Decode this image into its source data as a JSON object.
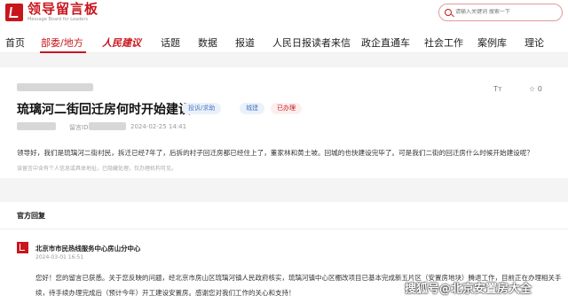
{
  "brand": {
    "name_cn": "领导留言板",
    "name_en": "Message Board for Leaders"
  },
  "search": {
    "placeholder": "请输入关键词 搜索一下"
  },
  "nav": {
    "items": [
      "首页",
      "部委/地方",
      "人民建议",
      "话题",
      "数据",
      "报道",
      "人民日报读者来信",
      "政企直通车",
      "社会工作",
      "案例库",
      "理论"
    ]
  },
  "post": {
    "title": "琉璃河二街回迁房何时开始建设",
    "tags": [
      "投诉/求助",
      "城建",
      "已办理"
    ],
    "meta_label": "留言ID",
    "date": "2024-02-25 14:41",
    "content": "领导好，我们是琉璃河二街村民，拆迁已经7年了，后拆的村子回迁房都已经住上了，董家林和黄土坡。回城的也快建设完毕了。可是我们二街的回迁房什么时候开始建设呢？",
    "notice": "该留言中含有个人信息或具体地址，已隐藏处理，仅办理机构可见。",
    "font_tool": "Tт",
    "like_count": "0"
  },
  "reply": {
    "section_title": "官方回复",
    "dept": "北京市市民热线服务中心房山分中心",
    "date": "2024-03-01 16:51",
    "content": "您好！您的留言已获悉。关于您反映的问题，经北京市房山区琉璃河镇人民政府核实，琉璃河镇中心区棚改项目已基本完成新五片区（安置房地块）腾退工作，目前正在办理相关手续，待手续办理完成后（预计今年）开工建设安置房。感谢您对我们工作的关心和支持！"
  },
  "watermark": "搜狐号@北京安置房大全",
  "colors": {
    "brand": "#c8161d",
    "tag_blue_bg": "#eaf1fb",
    "tag_blue_text": "#4a7cc4",
    "tag_red_text": "#c8161d"
  }
}
